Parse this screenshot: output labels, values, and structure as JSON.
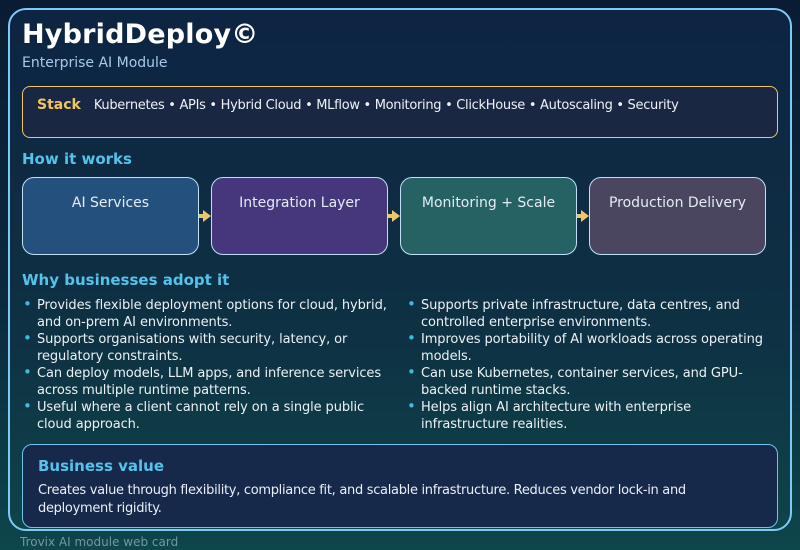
{
  "header": {
    "title": "HybridDeploy©",
    "subtitle": "Enterprise AI Module"
  },
  "stack": {
    "label": "Stack",
    "items": "Kubernetes • APIs • Hybrid Cloud • MLflow • Monitoring • ClickHouse • Autoscaling • Security"
  },
  "how_it_works": {
    "heading": "How it works",
    "steps": [
      {
        "label": "AI Services",
        "color": "#24507e"
      },
      {
        "label": "Integration Layer",
        "color": "#46377c"
      },
      {
        "label": "Monitoring + Scale",
        "color": "#266164"
      },
      {
        "label": "Production Delivery",
        "color": "#4b4660"
      }
    ]
  },
  "why": {
    "heading": "Why businesses adopt it",
    "left": [
      "Provides flexible deployment options for cloud, hybrid, and on-prem AI environments.",
      "Supports organisations with security, latency, or regulatory constraints.",
      "Can deploy models, LLM apps, and inference services across multiple runtime patterns.",
      "Useful where a client cannot rely on a single public cloud approach."
    ],
    "right": [
      "Supports private infrastructure, data centres, and controlled enterprise environments.",
      "Improves portability of AI workloads across operating models.",
      "Can use Kubernetes, container services, and GPU-backed runtime stacks.",
      "Helps align AI architecture with enterprise infrastructure realities."
    ]
  },
  "business_value": {
    "heading": "Business value",
    "text": "Creates value through flexibility, compliance fit, and scalable infrastructure. Reduces vendor lock-in and deployment rigidity."
  },
  "footer": {
    "text": "Trovix AI module web card"
  },
  "colors": {
    "card_border": "#7ec9f5",
    "stack_border_gold": "#ecc668",
    "stack_label_gold": "#f0c75f",
    "heading_cyan": "#55c2ea",
    "bullet_dot": "#41b9de"
  }
}
